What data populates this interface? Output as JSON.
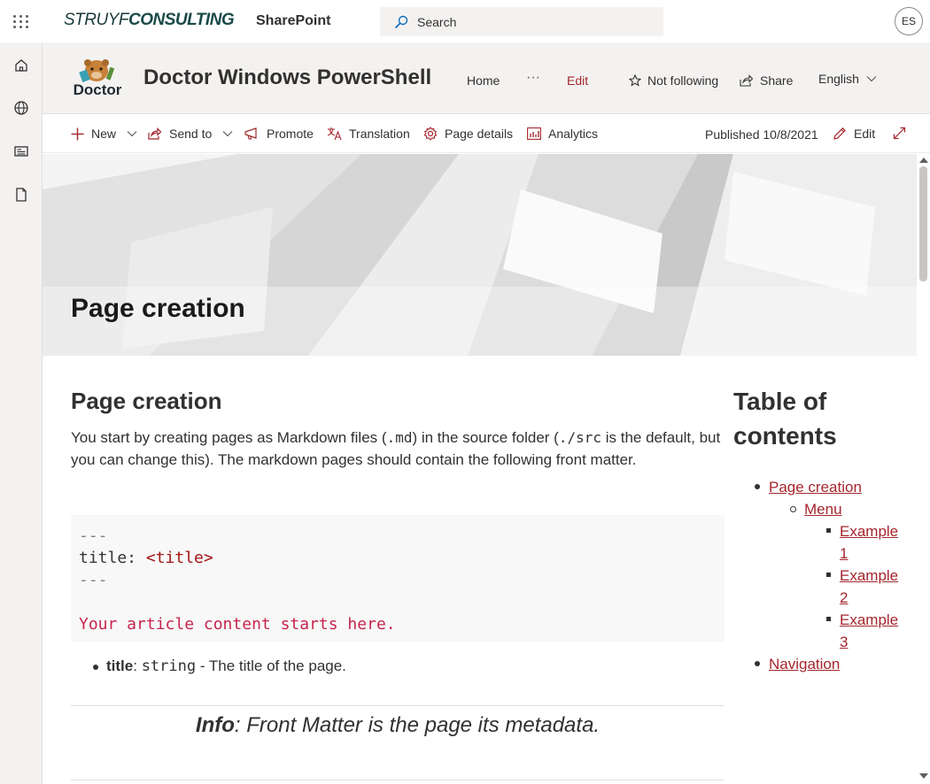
{
  "suite": {
    "brand_light": "STRUYF",
    "brand_bold": "CONSULTING",
    "app_name": "SharePoint",
    "search_placeholder": "Search",
    "avatar_initials": "ES"
  },
  "left_rail": {
    "items": [
      {
        "icon": "home-icon"
      },
      {
        "icon": "globe-icon"
      },
      {
        "icon": "news-icon"
      },
      {
        "icon": "document-icon"
      }
    ]
  },
  "site": {
    "logo_text": "Doctor",
    "title": "Doctor Windows PowerShell",
    "nav_home": "Home",
    "nav_more": "···",
    "nav_edit": "Edit",
    "follow_label": "Not following",
    "share_label": "Share",
    "language": "English"
  },
  "command_bar": {
    "new_label": "New",
    "send_to_label": "Send to",
    "promote_label": "Promote",
    "translation_label": "Translation",
    "page_details_label": "Page details",
    "analytics_label": "Analytics",
    "published_label": "Published 10/8/2021",
    "edit_label": "Edit"
  },
  "hero": {
    "title": "Page creation"
  },
  "article": {
    "heading": "Page creation",
    "intro_1": "You start by creating pages as Markdown files (",
    "intro_code_1": ".md",
    "intro_2": ") in the source folder (",
    "intro_code_2": "./src",
    "intro_3": " is the default, but you can change this). The markdown pages should contain the following front matter.",
    "code_dashes": "---",
    "code_title_key": "title: ",
    "code_title_value": "<title>",
    "code_content": "Your article content starts here.",
    "bullet_term": "title",
    "bullet_sep": ": ",
    "bullet_code": "string",
    "bullet_desc": " - The title of the page.",
    "info_term": "Info",
    "info_text": ": Front Matter is the page its metadata."
  },
  "toc": {
    "heading": "Table of contents",
    "items": [
      {
        "label": "Page creation",
        "level": 1
      },
      {
        "label": "Menu",
        "level": 2
      },
      {
        "label": "Example 1",
        "level": 3
      },
      {
        "label": "Example 2",
        "level": 3
      },
      {
        "label": "Example 3",
        "level": 3
      },
      {
        "label": "Navigation",
        "level": 1
      }
    ]
  },
  "colors": {
    "accent": "#a4262c",
    "rail_bg": "#f3f2f1",
    "header_bg": "#f3f2f1"
  }
}
